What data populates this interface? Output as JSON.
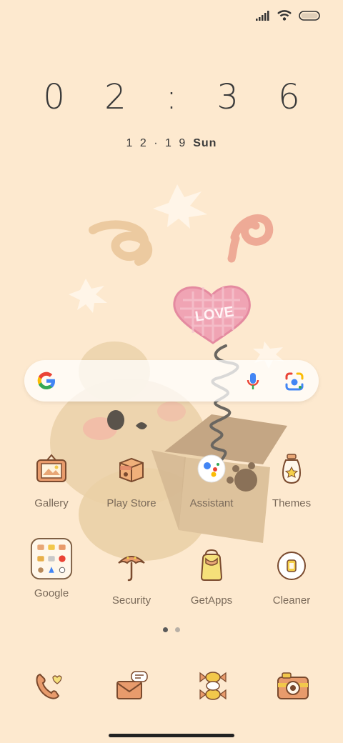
{
  "clock": {
    "time": "0 2 : 3 6"
  },
  "date": {
    "day": "1 2 · 1 9",
    "weekday": "Sun"
  },
  "page_indicator": {
    "count": 2,
    "active": 1
  },
  "apps": [
    {
      "label": "Gallery",
      "icon": "gallery-icon"
    },
    {
      "label": "Play Store",
      "icon": "play-store-icon"
    },
    {
      "label": "Assistant",
      "icon": "assistant-icon"
    },
    {
      "label": "Themes",
      "icon": "themes-icon"
    },
    {
      "label": "Google",
      "icon": "google-folder-icon"
    },
    {
      "label": "Security",
      "icon": "security-icon"
    },
    {
      "label": "GetApps",
      "icon": "getapps-icon"
    },
    {
      "label": "Cleaner",
      "icon": "cleaner-icon"
    }
  ],
  "dock": [
    {
      "icon": "phone-icon"
    },
    {
      "icon": "messages-icon"
    },
    {
      "icon": "candy-icon"
    },
    {
      "icon": "camera-icon"
    }
  ],
  "wallpaper": {
    "balloon_text": "LOVE"
  },
  "colors": {
    "background": "#fde9cf",
    "text_dark": "#3a3a3a",
    "label": "#7a6a5a"
  }
}
